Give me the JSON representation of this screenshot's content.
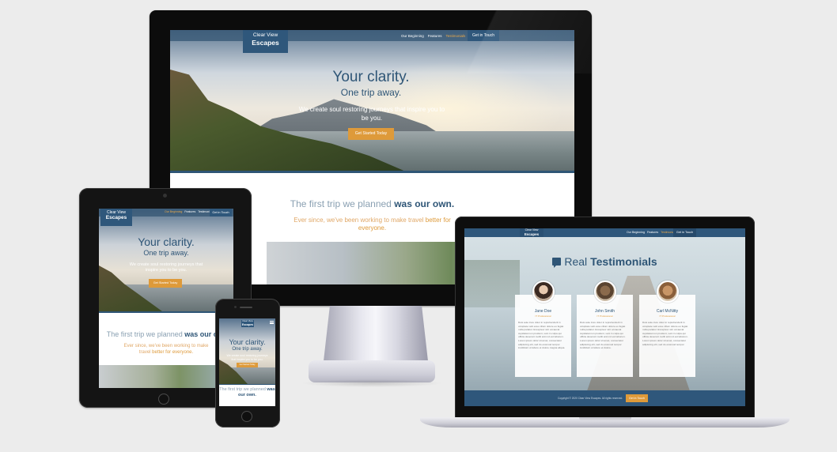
{
  "brand": {
    "line1": "Clear View",
    "line2": "Escapes"
  },
  "nav": {
    "items": [
      "Our Beginning",
      "Features",
      "Testimonials"
    ],
    "cta": "Get in Touch"
  },
  "hero": {
    "title": "Your clarity.",
    "subtitle": "One trip away.",
    "tagline": "We create soul restoring journeys that inspire you to be you.",
    "button": "Get Started Today"
  },
  "beginning": {
    "heading_lead": "The first trip we planned",
    "heading_bold": "was our own.",
    "body_lead": "Ever since, we've been working to make travel",
    "body_highlight": "better for everyone."
  },
  "testimonials": {
    "title_lead": "Real",
    "title_bold": "Testimonials",
    "people": [
      {
        "name": "Jane Doe",
        "role": "IT Professional",
        "quote": "Duis aute irure dolor in reprehenderit in voluptate velit esse cillum dolore eu fugiat nulla pariatur. Excepteur sint occaecat cupidatat non proident, sunt in culpa qui officia deserunt mollit anim id est laborum. Lorem ipsum dolor sit amet, consectetur adipiscing elit, sed do eiusmod tempor incididunt ut labore et dolore magna aliqua."
      },
      {
        "name": "John Smith",
        "role": "IT Professional",
        "quote": "Duis aute irure dolor in reprehenderit in voluptate velit esse cillum dolore eu fugiat nulla pariatur. Excepteur sint occaecat cupidatat non proident, sunt in culpa qui officia deserunt mollit anim id est laborum. Lorem ipsum dolor sit amet, consectetur adipiscing elit, sed do eiusmod tempor incididunt ut labore et dolore."
      },
      {
        "name": "Carl McNitty",
        "role": "IT Professional",
        "quote": "Duis aute irure dolor in reprehenderit in voluptate velit esse cillum dolore eu fugiat nulla pariatur. Excepteur sint occaecat cupidatat non proident, sunt in culpa qui officia deserunt mollit anim id est laborum. Lorem ipsum dolor sit amet, consectetur adipiscing elit, sed do eiusmod tempor."
      }
    ]
  },
  "footer": {
    "copyright": "Copyright © 2020 Clear View Escapes. All rights reserved.",
    "cta": "Get in Touch"
  },
  "colors": {
    "brand_blue": "#2f577b",
    "accent_orange": "#de9a3a",
    "background": "#ececec"
  }
}
